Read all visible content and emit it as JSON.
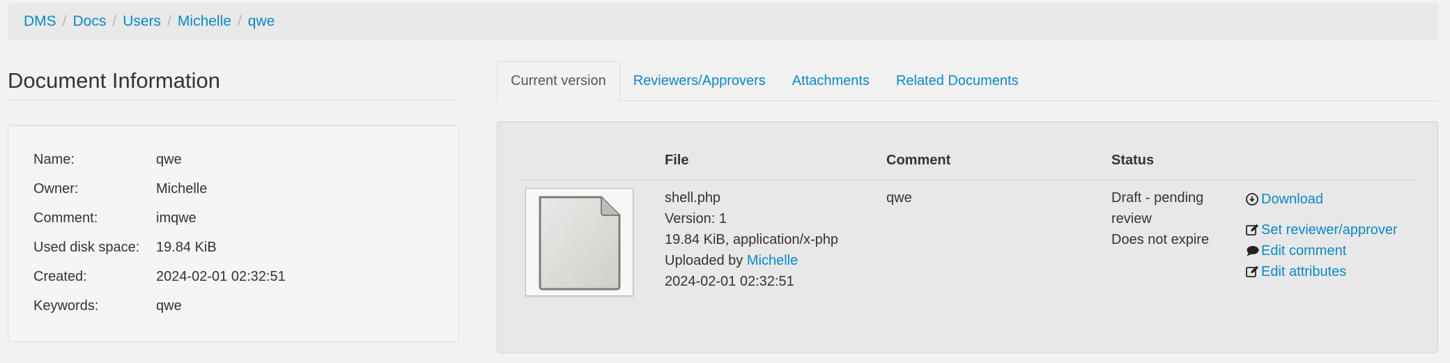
{
  "breadcrumb": {
    "items": [
      "DMS",
      "Docs",
      "Users",
      "Michelle",
      "qwe"
    ],
    "separator": "/"
  },
  "left": {
    "title": "Document Information",
    "rows": [
      {
        "label": "Name:",
        "value": "qwe",
        "link": false
      },
      {
        "label": "Owner:",
        "value": "Michelle",
        "link": true
      },
      {
        "label": "Comment:",
        "value": "imqwe",
        "link": false
      },
      {
        "label": "Used disk space:",
        "value": "19.84 KiB",
        "link": false
      },
      {
        "label": "Created:",
        "value": "2024-02-01 02:32:51",
        "link": false
      },
      {
        "label": "Keywords:",
        "value": "qwe",
        "link": false
      }
    ]
  },
  "tabs": [
    "Current version",
    "Reviewers/Approvers",
    "Attachments",
    "Related Documents"
  ],
  "version": {
    "headers": {
      "file": "File",
      "comment": "Comment",
      "status": "Status"
    },
    "file": {
      "name": "shell.php",
      "version": "Version: 1",
      "size_type": "19.84 KiB, application/x-php",
      "uploaded_prefix": "Uploaded by",
      "uploader": "Michelle",
      "date": "2024-02-01 02:32:51"
    },
    "comment": "qwe",
    "status": {
      "line1": "Draft - pending",
      "line2": "review",
      "line3": "Does not expire"
    },
    "actions": {
      "download": "Download",
      "set_reviewer": "Set reviewer/approver",
      "edit_comment": "Edit comment",
      "edit_attributes": "Edit attributes"
    }
  },
  "colors": {
    "link": "#0a88c6",
    "background": "#f2f2f2"
  },
  "icons": [
    "download-circle-icon",
    "edit-icon",
    "comment-icon",
    "file-thumbnail-icon"
  ]
}
